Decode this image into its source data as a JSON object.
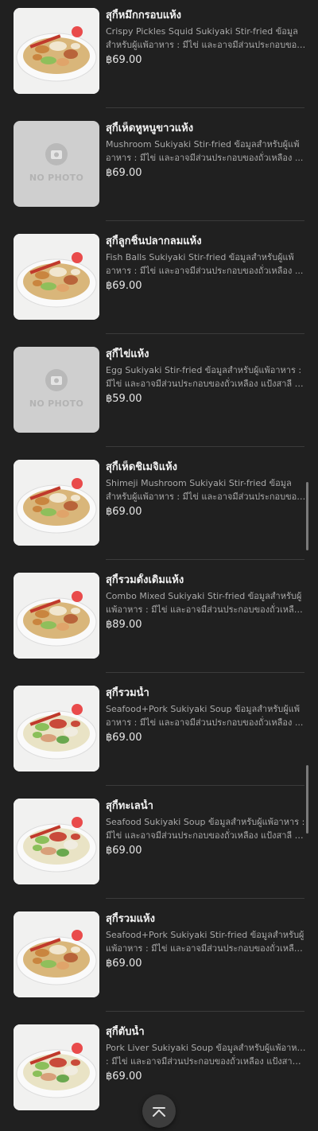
{
  "menu": {
    "items": [
      {
        "name": "สุกี้หมึกกรอบแห้ง",
        "desc1": "Crispy Pickles Squid Sukiyaki Stir-fried ข้อมูล",
        "desc2": "สำหรับผู้แพ้อาหาร : มีไข่ และอาจมีส่วนประกอบของ...",
        "price": "฿69.00",
        "photo": "dry"
      },
      {
        "name": "สุกี้เห็ดหูหนูขาวแห้ง",
        "desc1": "Mushroom Sukiyaki Stir-fried ข้อมูลสำหรับผู้แพ้",
        "desc2": "อาหาร : มีไข่ และอาจมีส่วนประกอบของถั่วเหลือง ...",
        "price": "฿69.00",
        "photo": "none"
      },
      {
        "name": "สุกี้ลูกชิ้นปลากลมแห้ง",
        "desc1": "Fish Balls Sukiyaki Stir-fried ข้อมูลสำหรับผู้แพ้",
        "desc2": "อาหาร : มีไข่ และอาจมีส่วนประกอบของถั่วเหลือง ...",
        "price": "฿69.00",
        "photo": "dry"
      },
      {
        "name": "สุกี้ไข่แห้ง",
        "desc1": "Egg Sukiyaki Stir-fried ข้อมูลสำหรับผู้แพ้อาหาร :",
        "desc2": "มีไข่ และอาจมีส่วนประกอบของถั่วเหลือง แป้งสาลี แล...",
        "price": "฿59.00",
        "photo": "none"
      },
      {
        "name": "สุกี้เห็ดชิเมจิแห้ง",
        "desc1": "Shimeji Mushroom Sukiyaki Stir-fried ข้อมูล",
        "desc2": "สำหรับผู้แพ้อาหาร : มีไข่ และอาจมีส่วนประกอบของ...",
        "price": "฿69.00",
        "photo": "dry"
      },
      {
        "name": "สุกี้รวมดั้งเดิมแห้ง",
        "desc1": "Combo Mixed Sukiyaki Stir-fried ข้อมูลสำหรับผู้",
        "desc2": "แพ้อาหาร : มีไข่ และอาจมีส่วนประกอบของถั่วเหลือง...",
        "price": "฿89.00",
        "photo": "dry"
      },
      {
        "name": "สุกี้รวมน้ำ",
        "desc1": "Seafood+Pork Sukiyaki Soup ข้อมูลสำหรับผู้แพ้",
        "desc2": "อาหาร : มีไข่ และอาจมีส่วนประกอบของถั่วเหลือง ...",
        "price": "฿69.00",
        "photo": "soup"
      },
      {
        "name": "สุกี้ทะเลน้ำ",
        "desc1": "Seafood Sukiyaki Soup ข้อมูลสำหรับผู้แพ้อาหาร :",
        "desc2": "มีไข่ และอาจมีส่วนประกอบของถั่วเหลือง แป้งสาลี แล...",
        "price": "฿69.00",
        "photo": "soup"
      },
      {
        "name": "สุกี้รวมแห้ง",
        "desc1": "Seafood+Pork Sukiyaki Stir-fried ข้อมูลสำหรับผู้",
        "desc2": "แพ้อาหาร : มีไข่ และอาจมีส่วนประกอบของถั่วเหลือง...",
        "price": "฿69.00",
        "photo": "dry"
      },
      {
        "name": "สุกี้ตับน้ำ",
        "desc1": "Pork Liver Sukiyaki Soup ข้อมูลสำหรับผู้แพ้อาหาร",
        "desc2": ": มีไข่ และอาจมีส่วนประกอบของถั่วเหลือง แป้งสาลี แ...",
        "price": "฿69.00",
        "photo": "soup"
      }
    ],
    "no_photo_label": "NO PHOTO"
  },
  "icons": {
    "no_photo": "camera-icon",
    "scroll_top": "chevron-up-icon"
  },
  "colors": {
    "background": "#202020",
    "text_primary": "#f2f2f2",
    "text_secondary": "#a9a9a9",
    "divider": "#3b3b3b"
  }
}
